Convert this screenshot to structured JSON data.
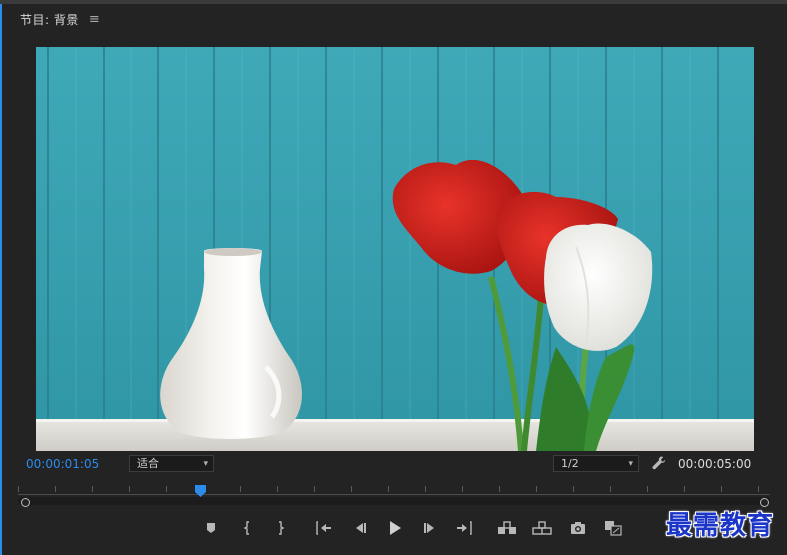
{
  "panel": {
    "title": "节目: 背景",
    "menu_icon": "≡"
  },
  "controls": {
    "current_timecode": "00:00:01:05",
    "zoom_select": {
      "value": "适合",
      "caret": "⌄"
    },
    "resolution_select": {
      "value": "1/2",
      "caret": "⌄"
    },
    "duration_timecode": "00:00:05:00",
    "settings_icon": "wrench-icon"
  },
  "transport": {
    "buttons": [
      "add-marker",
      "mark-in",
      "mark-out",
      "go-to-in",
      "step-back",
      "play",
      "step-forward",
      "go-to-out",
      "insert",
      "overwrite",
      "export-frame",
      "comparison-view"
    ]
  },
  "watermark": "最需教育",
  "colors": {
    "accent": "#2d8ceb",
    "panel_bg": "#232323",
    "watermark": "#1a35c8"
  }
}
